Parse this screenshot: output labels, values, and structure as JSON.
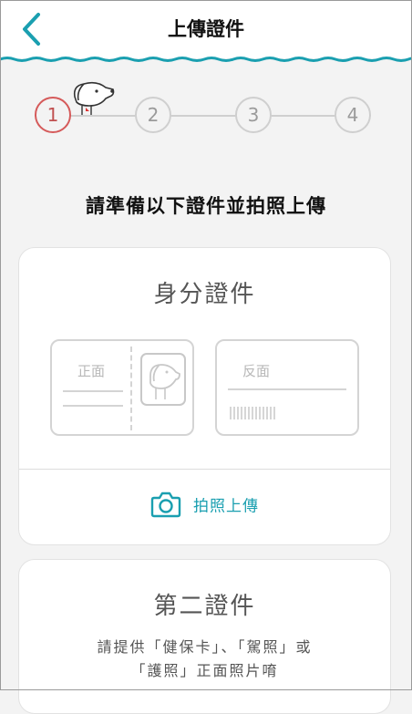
{
  "header": {
    "title": "上傳證件"
  },
  "stepper": {
    "steps": [
      "1",
      "2",
      "3",
      "4"
    ],
    "active_step": 1
  },
  "instruction": "請準備以下證件並拍照上傳",
  "id_card": {
    "title": "身分證件",
    "front_label": "正面",
    "back_label": "反面",
    "upload_label": "拍照上傳"
  },
  "second_card": {
    "title": "第二證件",
    "desc_line1": "請提供「健保卡」、「駕照」或",
    "desc_line2": "「護照」正面照片唷"
  },
  "colors": {
    "accent": "#1a9fb0",
    "active_step": "#d55a5a",
    "inactive": "#cfcfcf"
  }
}
